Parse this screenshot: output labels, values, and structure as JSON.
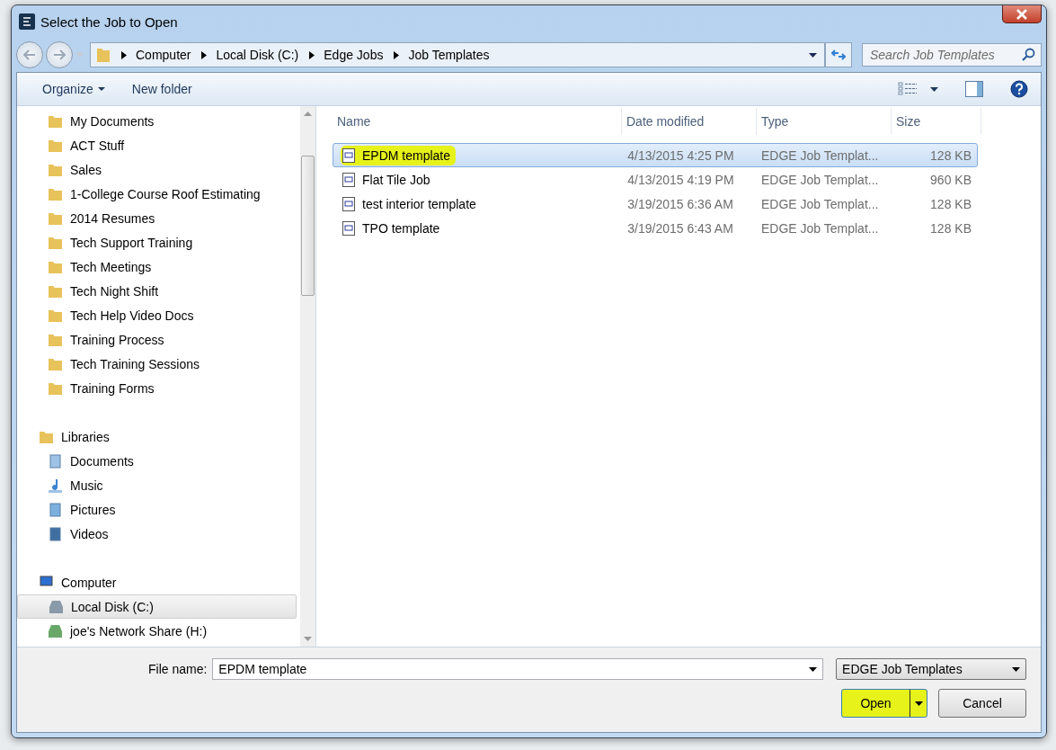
{
  "window": {
    "title": "Select the Job to Open"
  },
  "breadcrumb": [
    "Computer",
    "Local Disk (C:)",
    "Edge Jobs",
    "Job Templates"
  ],
  "search": {
    "placeholder": "Search Job Templates"
  },
  "toolbar": {
    "organize": "Organize",
    "new_folder": "New folder"
  },
  "nav": [
    {
      "label": "My Documents",
      "kind": "folder",
      "selected": false
    },
    {
      "label": "ACT Stuff",
      "kind": "folder",
      "selected": false
    },
    {
      "label": "Sales",
      "kind": "folder",
      "selected": false
    },
    {
      "label": "1-College Course Roof Estimating",
      "kind": "folder",
      "selected": false
    },
    {
      "label": "2014 Resumes",
      "kind": "folder",
      "selected": false
    },
    {
      "label": "Tech Support Training",
      "kind": "folder",
      "selected": false
    },
    {
      "label": "Tech Meetings",
      "kind": "folder",
      "selected": false
    },
    {
      "label": "Tech Night Shift",
      "kind": "folder",
      "selected": false
    },
    {
      "label": "Tech Help Video Docs",
      "kind": "folder",
      "selected": false
    },
    {
      "label": "Training Process",
      "kind": "folder",
      "selected": false
    },
    {
      "label": "Tech Training Sessions",
      "kind": "folder",
      "selected": false
    },
    {
      "label": "Training Forms",
      "kind": "folder",
      "selected": false
    },
    {
      "label": "Libraries",
      "kind": "library",
      "selected": false,
      "children": [
        {
          "label": "Documents",
          "kind": "documents",
          "selected": false
        },
        {
          "label": "Music",
          "kind": "music",
          "selected": false
        },
        {
          "label": "Pictures",
          "kind": "pictures",
          "selected": false
        },
        {
          "label": "Videos",
          "kind": "videos",
          "selected": false
        }
      ]
    },
    {
      "label": "Computer",
      "kind": "computer",
      "selected": false,
      "children": [
        {
          "label": "Local Disk (C:)",
          "kind": "drive",
          "selected": true
        },
        {
          "label": "joe's Network Share (H:)",
          "kind": "network",
          "selected": false
        }
      ]
    }
  ],
  "columns": [
    "Name",
    "Date modified",
    "Type",
    "Size"
  ],
  "files": [
    {
      "name": "EPDM template",
      "date": "4/13/2015 4:25 PM",
      "type": "EDGE Job Templat...",
      "size": "128 KB",
      "selected": true,
      "highlighted": true
    },
    {
      "name": "Flat Tile Job",
      "date": "4/13/2015 4:19 PM",
      "type": "EDGE Job Templat...",
      "size": "960 KB",
      "selected": false,
      "highlighted": false
    },
    {
      "name": "test interior template",
      "date": "3/19/2015 6:36 AM",
      "type": "EDGE Job Templat...",
      "size": "128 KB",
      "selected": false,
      "highlighted": false
    },
    {
      "name": "TPO template",
      "date": "3/19/2015 6:43 AM",
      "type": "EDGE Job Templat...",
      "size": "128 KB",
      "selected": false,
      "highlighted": false
    }
  ],
  "file_name": {
    "label": "File name:",
    "value": "EPDM template"
  },
  "file_type": "EDGE Job Templates",
  "buttons": {
    "open": {
      "label": "Open",
      "highlighted": true
    },
    "cancel": "Cancel"
  }
}
